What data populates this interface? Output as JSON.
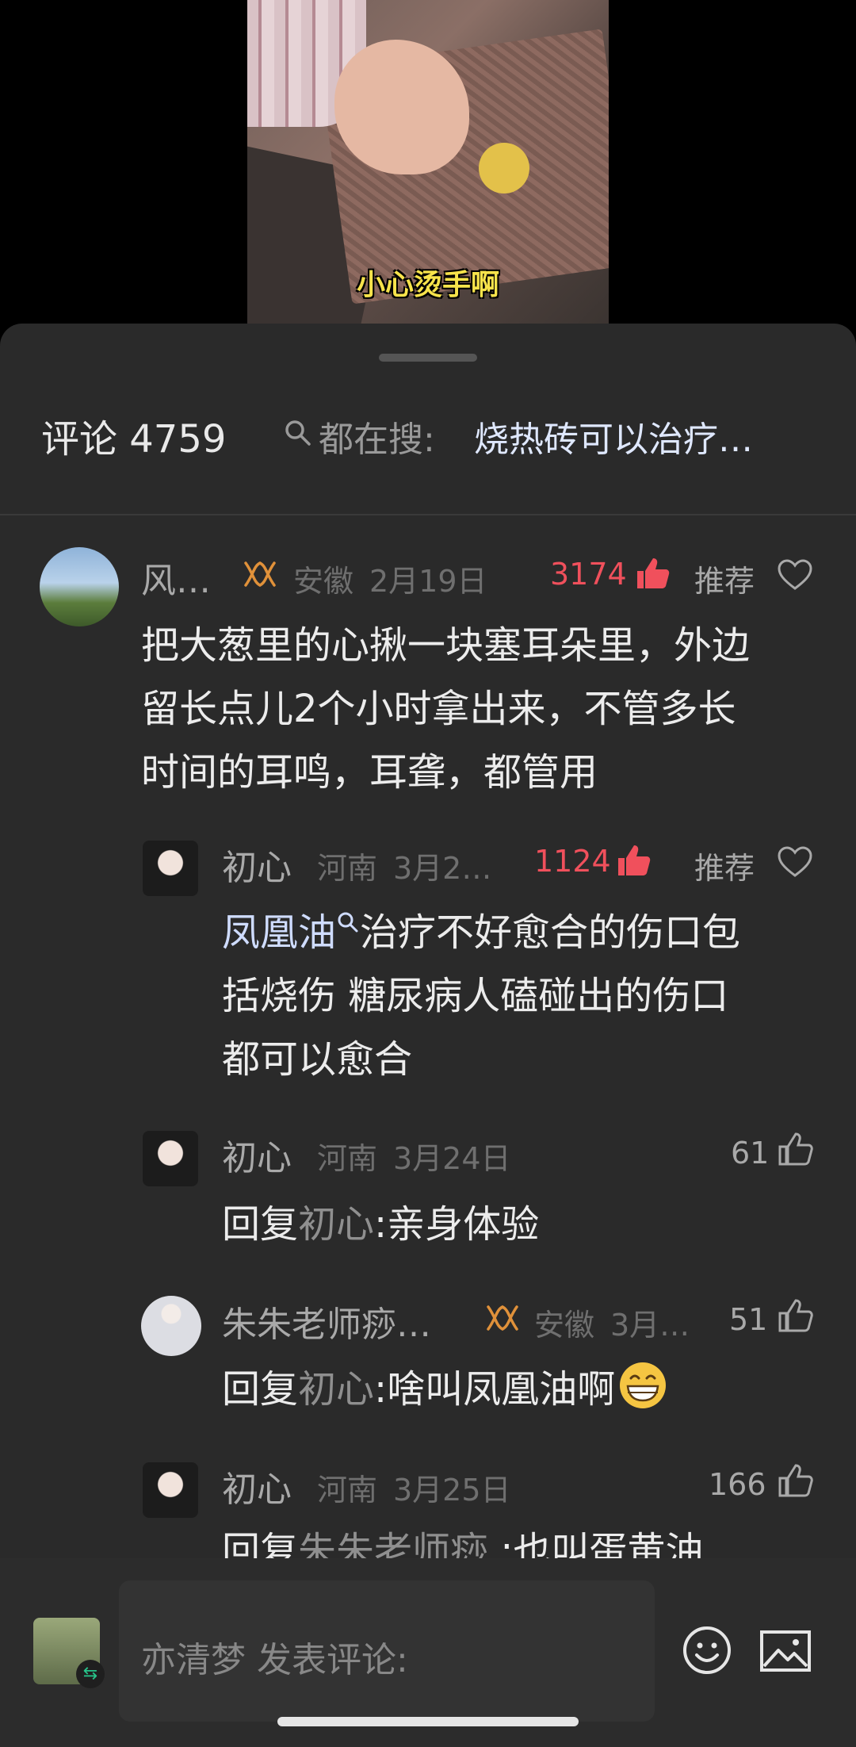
{
  "video": {
    "caption": "小心烫手啊"
  },
  "comments_header": {
    "title": "评论 4759",
    "search_prefix": "都在搜:",
    "search_query": "烧热砖可以治疗…"
  },
  "comments": [
    {
      "name": "风…",
      "location": "安徽",
      "date": "2月19日",
      "likes": "3174",
      "recommend": "推荐",
      "text_lines": [
        "把大葱里的心揪一块塞耳朵里，外边",
        "留长点儿2个小时拿出来，不管多长",
        "时间的耳鸣，耳聋，都管用"
      ]
    },
    {
      "name": "初心",
      "location": "河南",
      "date": "3月2…",
      "likes": "1124",
      "recommend": "推荐",
      "link_text": "凤凰油",
      "text_lines": [
        "治疗不好愈合的伤口包",
        "括烧伤  糖尿病人磕碰出的伤口",
        "都可以愈合"
      ]
    },
    {
      "name": "初心",
      "location": "河南",
      "date": "3月24日",
      "likes": "61",
      "reply_prefix": "回复",
      "reply_user": "初心",
      "text": ":亲身体验"
    },
    {
      "name": "朱朱老师痧…",
      "location": "安徽",
      "date": "3月…",
      "likes": "51",
      "reply_prefix": "回复",
      "reply_user": "初心",
      "text": ":啥叫凤凰油啊"
    },
    {
      "name": "初心",
      "location": "河南",
      "date": "3月25日",
      "likes": "166",
      "reply_prefix": "回复",
      "reply_user": "朱朱老师痧",
      "text": "  :也叫蛋黄油"
    }
  ],
  "composer": {
    "placeholder": "亦清梦 发表评论:"
  },
  "colors": {
    "accent_red": "#f0505c",
    "link_blue": "#cfdcff",
    "badge_orange": "#e0913a"
  },
  "icons": [
    "search-icon",
    "like-thumb-icon",
    "heart-icon",
    "crown-badge-icon",
    "emoji-icon",
    "image-icon",
    "grin-emoji-icon"
  ]
}
